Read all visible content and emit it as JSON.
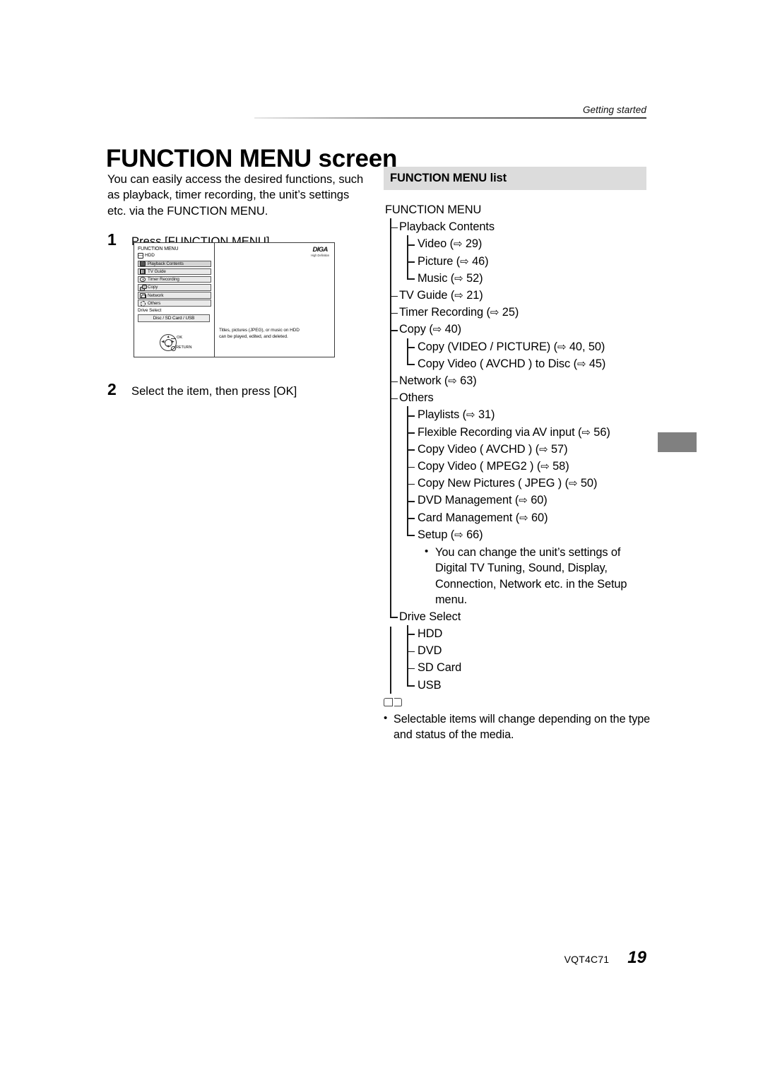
{
  "header": {
    "section": "Getting started"
  },
  "title": {
    "bold_part": "FUNCTION MENU",
    "light_part": "screen"
  },
  "intro": "You can easily access the desired functions, such as playback, timer recording, the unit’s settings etc. via the FUNCTION MENU.",
  "steps": [
    {
      "num": "1",
      "text": "Press [FUNCTION MENU]."
    },
    {
      "num": "2",
      "text": "Select the item, then press [OK]"
    }
  ],
  "screen": {
    "menu_title": "FUNCTION MENU",
    "drive_label": "HDD",
    "items": [
      {
        "label": "Playback Contents",
        "icon": "folder-icon",
        "selected": true
      },
      {
        "label": "TV Guide",
        "icon": "grid-icon",
        "selected": false
      },
      {
        "label": "Timer Recording",
        "icon": "clock-icon",
        "selected": false
      },
      {
        "label": "Copy",
        "icon": "copy-icon",
        "selected": false
      },
      {
        "label": "Network",
        "icon": "network-icon",
        "selected": false
      },
      {
        "label": "Others",
        "icon": "gear-icon",
        "selected": false
      }
    ],
    "drive_select_label": "Drive Select",
    "drive_select_value": "Disc / SD Card / USB",
    "dpad": {
      "ok": "OK",
      "return": "RETURN"
    },
    "brand": {
      "name": "DIGA",
      "subtitle": "High Definition"
    },
    "description_line1": "Titles, pictures (JPEG), or music on HDD",
    "description_line2": "can be played, edited, and deleted."
  },
  "list_section": {
    "heading": "FUNCTION MENU list",
    "root": "FUNCTION MENU",
    "playback_contents": "Playback Contents",
    "playback_children": [
      {
        "label": "Video",
        "ref": "29"
      },
      {
        "label": "Picture",
        "ref": "46"
      },
      {
        "label": "Music",
        "ref": "52"
      }
    ],
    "tv_guide": {
      "label": "TV Guide",
      "ref": "21"
    },
    "timer_recording": {
      "label": "Timer Recording",
      "ref": "25"
    },
    "copy": {
      "label": "Copy",
      "ref": "40"
    },
    "copy_children": [
      {
        "label": "Copy (VIDEO / PICTURE)",
        "ref": "40, 50"
      },
      {
        "label": "Copy Video ( AVCHD ) to Disc",
        "ref": "45"
      }
    ],
    "network": {
      "label": "Network",
      "ref": "63"
    },
    "others": "Others",
    "others_children": [
      {
        "label": "Playlists",
        "ref": "31"
      },
      {
        "label": "Flexible Recording via AV input",
        "ref": "56"
      },
      {
        "label": "Copy Video ( AVCHD )",
        "ref": "57"
      },
      {
        "label": "Copy Video ( MPEG2 )",
        "ref": "58"
      },
      {
        "label": "Copy New Pictures ( JPEG )",
        "ref": "50"
      },
      {
        "label": "DVD Management",
        "ref": "60"
      },
      {
        "label": "Card Management",
        "ref": "60"
      },
      {
        "label": "Setup",
        "ref": "66"
      }
    ],
    "setup_note": "You can change the unit’s settings of Digital TV Tuning, Sound, Display, Connection, Network etc. in the Setup menu.",
    "drive_select": "Drive Select",
    "drive_select_children": [
      "HDD",
      "DVD",
      "SD Card",
      "USB"
    ]
  },
  "footnote": {
    "icon": "open-book-icon",
    "text": "Selectable items will change depending on the type and status of the media."
  },
  "footer": {
    "code": "VQT4C71",
    "page": "19"
  },
  "arrow_glyph": "⇨"
}
